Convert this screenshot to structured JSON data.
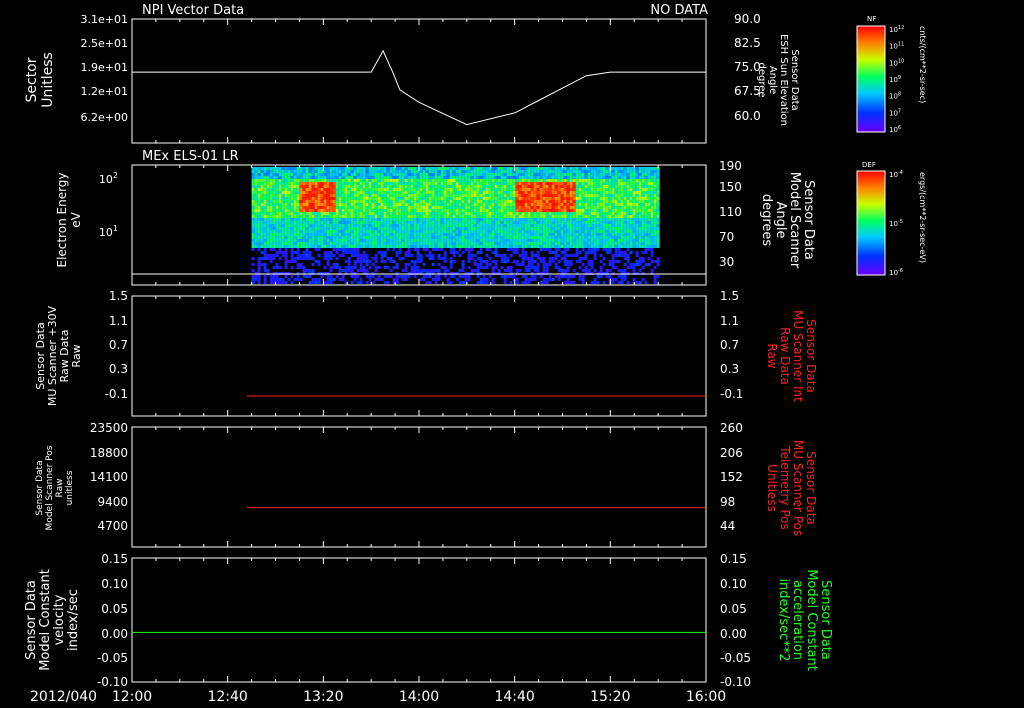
{
  "bottom_axis": {
    "date_label": "2012/040",
    "ticks": [
      "12:00",
      "12:40",
      "13:20",
      "14:00",
      "14:40",
      "15:20",
      "16:00"
    ]
  },
  "panels": [
    {
      "id": "sector",
      "title": "NPI Vector Data",
      "status_right": "NO DATA",
      "left_label": [
        "Sector",
        "Unitless"
      ],
      "left_ticks": [
        "3.1e+01",
        "2.5e+01",
        "1.9e+01",
        "1.2e+01",
        "6.2e+00"
      ],
      "right_label": [
        "Sensor Data",
        "ESH Sun Elevation",
        "Angle",
        "degree"
      ],
      "right_ticks": [
        "90.0",
        "82.5",
        "75.0",
        "67.5",
        "60.0"
      ],
      "line_color": "#ffffff"
    },
    {
      "id": "els",
      "title": "MEx ELS-01 LR",
      "left_label": [
        "Electron Energy",
        "eV"
      ],
      "left_ticks": [
        "10^2",
        "10^1"
      ],
      "right_label": [
        "Sensor Data",
        "Model Scanner",
        "Angle",
        "degrees"
      ],
      "right_ticks": [
        "190",
        "150",
        "110",
        "70",
        "30"
      ]
    },
    {
      "id": "mu_raw",
      "left_label": [
        "Sensor Data",
        "MU Scanner +30V",
        "Raw Data",
        "Raw"
      ],
      "left_ticks": [
        "1.5",
        "1.1",
        "0.7",
        "0.3",
        "-0.1"
      ],
      "right_label": [
        "Sensor Data",
        "MU Scanner Int",
        "Raw Data",
        "Raw"
      ],
      "right_ticks": [
        "1.5",
        "1.1",
        "0.7",
        "0.3",
        "-0.1"
      ],
      "right_color": "#ff2020",
      "line_color": "#ff2020"
    },
    {
      "id": "mu_pos",
      "left_label": [
        "Sensor Data",
        "Model Scanner Pos",
        "Raw",
        "unitless"
      ],
      "left_ticks": [
        "23500",
        "18800",
        "14100",
        "9400",
        "4700"
      ],
      "right_label": [
        "Sensor Data",
        "MU Scanner Pos",
        "Telemetry Pos",
        "Unitless"
      ],
      "right_ticks": [
        "260",
        "206",
        "152",
        "98",
        "44"
      ],
      "right_color": "#ff2020",
      "line_color": "#ff2020"
    },
    {
      "id": "velocity",
      "left_label": [
        "Sensor Data",
        "Model Constant",
        "velocity",
        "index/sec"
      ],
      "left_ticks": [
        "0.15",
        "0.10",
        "0.05",
        "0.00",
        "-0.05",
        "-0.10"
      ],
      "right_label": [
        "Sensor Data",
        "Model Constant",
        "acceleration",
        "index/sec**2"
      ],
      "right_ticks": [
        "0.15",
        "0.10",
        "0.05",
        "0.00",
        "-0.05",
        "-0.10"
      ],
      "right_color": "#20ff20",
      "line_color": "#20ff20"
    }
  ],
  "colorbars": [
    {
      "id": "nf",
      "title": "NF",
      "unit": "cnts/(cm**2-sr-sec)",
      "ticks": [
        "10^12",
        "10^11",
        "10^10",
        "10^9",
        "10^8",
        "10^7",
        "10^6"
      ]
    },
    {
      "id": "def",
      "title": "DEF",
      "unit": "ergs/(cm**2-sr-sec-eV)",
      "ticks": [
        "10^-4",
        "10^-5",
        "10^-6"
      ]
    }
  ],
  "chart_data": [
    {
      "type": "line",
      "title": "NPI Vector Data",
      "ylabel": "Sector Unitless",
      "y2label": "Sensor Data ESH Sun Elevation Angle degree",
      "xlim": [
        "12:00",
        "16:00"
      ],
      "y2lim": [
        55.0,
        90.0
      ],
      "x": [
        "12:00",
        "13:20",
        "13:40",
        "13:45",
        "13:49",
        "13:52",
        "14:00",
        "14:20",
        "14:40",
        "14:50",
        "15:00",
        "15:10",
        "15:20",
        "16:00"
      ],
      "series": [
        {
          "values": [
            75.0,
            75.0,
            75.0,
            81.0,
            75.0,
            70.0,
            66.5,
            60.2,
            63.5,
            67.0,
            70.5,
            74.0,
            75.0,
            75.0
          ]
        }
      ]
    },
    {
      "type": "heatmap",
      "title": "MEx ELS-01 LR",
      "ylabel": "Electron Energy eV",
      "y2label": "Sensor Data Model Scanner Angle degrees",
      "xlim": [
        "12:00",
        "16:00"
      ],
      "data_start": "12:50",
      "data_end": "15:40",
      "enhancement_intervals": [
        [
          "13:10",
          "13:25"
        ],
        [
          "14:40",
          "15:05"
        ]
      ],
      "y2_line_value": 5
    },
    {
      "type": "line",
      "ylabel": "Sensor Data MU Scanner +30V Raw Data Raw",
      "xlim": [
        "12:00",
        "16:00"
      ],
      "ylim": [
        -0.3,
        1.5
      ],
      "series": [
        {
          "x": [
            "12:48",
            "16:00"
          ],
          "values": [
            0.0,
            0.0
          ]
        }
      ]
    },
    {
      "type": "line",
      "ylabel": "Sensor Data Model Scanner Pos Raw unitless",
      "xlim": [
        "12:00",
        "16:00"
      ],
      "ylim": [
        0,
        23500
      ],
      "series": [
        {
          "x": [
            "12:48",
            "16:00"
          ],
          "values": [
            7700,
            7700
          ]
        }
      ]
    },
    {
      "type": "line",
      "ylabel": "Sensor Data Model Constant velocity index/sec",
      "xlim": [
        "12:00",
        "16:00"
      ],
      "ylim": [
        -0.1,
        0.15
      ],
      "series": [
        {
          "x": [
            "12:00",
            "16:00"
          ],
          "values": [
            0.0,
            0.0
          ]
        }
      ]
    }
  ]
}
